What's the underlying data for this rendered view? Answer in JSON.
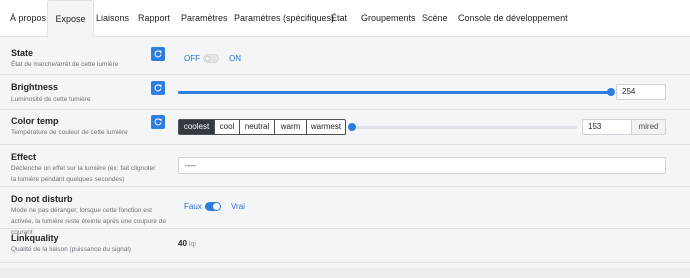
{
  "tabs": [
    {
      "label": "À propos",
      "active": false
    },
    {
      "label": "Expose",
      "active": true
    },
    {
      "label": "Liaisons",
      "active": false
    },
    {
      "label": "Rapport",
      "active": false
    },
    {
      "label": "Paramètres",
      "active": false
    },
    {
      "label": "Paramètres (spécifiques)",
      "active": false
    },
    {
      "label": "État",
      "active": false
    },
    {
      "label": "Groupements",
      "active": false
    },
    {
      "label": "Scène",
      "active": false
    },
    {
      "label": "Console de développement",
      "active": false
    }
  ],
  "state": {
    "label": "State",
    "description": "État de marche/arrêt de cette lumière",
    "off_label": "OFF",
    "on_label": "ON",
    "value": "OFF",
    "refresh_icon": "refresh-icon"
  },
  "brightness": {
    "label": "Brightness",
    "description": "Luminosité de cette lumière",
    "value": "254",
    "slider_fraction": 1.0,
    "refresh_icon": "refresh-icon"
  },
  "color_temp": {
    "label": "Color temp",
    "description": "Température de couleur de cette lumière",
    "presets": [
      "coolest",
      "cool",
      "neutral",
      "warm",
      "warmest"
    ],
    "selected_preset": "coolest",
    "value": "153",
    "unit": "mired",
    "slider_fraction": 0.0,
    "refresh_icon": "refresh-icon"
  },
  "effect": {
    "label": "Effect",
    "description": "Déclenche un effet sur la lumière (ex: fait clignoter la lumière pendant quelques secondes)",
    "selected": "----"
  },
  "do_not_disturb": {
    "label": "Do not disturb",
    "description": "Mode ne pas déranger, lorsque cette fonction est activée, la lumière reste éteinte après une coupure de courant",
    "false_label": "Faux",
    "true_label": "Vrai",
    "value": "Vrai"
  },
  "linkquality": {
    "label": "Linkquality",
    "description": "Qualité de la liaison (puissance du signal)",
    "value": "40",
    "unit": "lqi"
  },
  "colors": {
    "accent": "#2d7de2",
    "link_text": "#2f6fd4",
    "active_preset": "#343a40"
  }
}
